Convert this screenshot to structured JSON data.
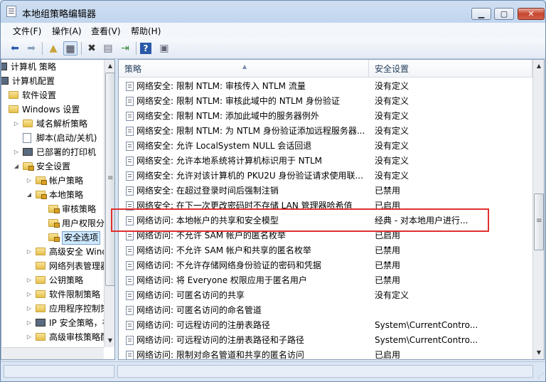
{
  "window": {
    "title": "本地组策略编辑器"
  },
  "menu": [
    "文件(F)",
    "操作(A)",
    "查看(V)",
    "帮助(H)"
  ],
  "toolbar": {
    "icons": [
      "back-arrow-icon",
      "forward-arrow-icon",
      "up-folder-icon",
      "show-hide-tree-icon",
      "delete-icon",
      "properties-icon",
      "export-list-icon",
      "help-icon",
      "view-icon"
    ]
  },
  "tree": [
    {
      "label": "计算机 策略",
      "indent": -6,
      "type": "pc",
      "expander": ""
    },
    {
      "label": "计算机配置",
      "indent": -4,
      "type": "pc",
      "expander": ""
    },
    {
      "label": "软件设置",
      "indent": 10,
      "type": "folder",
      "expander": ""
    },
    {
      "label": "Windows 设置",
      "indent": 10,
      "type": "folder",
      "expander": ""
    },
    {
      "label": "域名解析策略",
      "indent": 30,
      "type": "folder",
      "expander": "▷"
    },
    {
      "label": "脚本(启动/关机)",
      "indent": 30,
      "type": "doc",
      "expander": ""
    },
    {
      "label": "已部署的打印机",
      "indent": 30,
      "type": "pc",
      "expander": "▷"
    },
    {
      "label": "安全设置",
      "indent": 30,
      "type": "folder-lock",
      "expander": "◢"
    },
    {
      "label": "帐户策略",
      "indent": 48,
      "type": "folder-lock",
      "expander": "▷"
    },
    {
      "label": "本地策略",
      "indent": 48,
      "type": "folder-lock",
      "expander": "◢"
    },
    {
      "label": "审核策略",
      "indent": 66,
      "type": "folder-lock",
      "expander": ""
    },
    {
      "label": "用户权限分",
      "indent": 66,
      "type": "folder-lock",
      "expander": ""
    },
    {
      "label": "安全选项",
      "indent": 66,
      "type": "folder-lock",
      "expander": "",
      "selected": true
    },
    {
      "label": "高级安全 Wind",
      "indent": 48,
      "type": "folder",
      "expander": "▷"
    },
    {
      "label": "网络列表管理器",
      "indent": 48,
      "type": "folder",
      "expander": ""
    },
    {
      "label": "公钥策略",
      "indent": 48,
      "type": "folder",
      "expander": "▷"
    },
    {
      "label": "软件限制策略",
      "indent": 48,
      "type": "folder",
      "expander": "▷"
    },
    {
      "label": "应用程序控制策",
      "indent": 48,
      "type": "folder",
      "expander": "▷"
    },
    {
      "label": "IP 安全策略，在",
      "indent": 48,
      "type": "pc",
      "expander": "▷"
    },
    {
      "label": "高级审核策略配",
      "indent": 48,
      "type": "folder",
      "expander": "▷"
    }
  ],
  "columns": {
    "policy": "策略",
    "setting": "安全设置"
  },
  "rows": [
    {
      "policy": "网络安全: 限制 NTLM: 审核传入 NTLM 流量",
      "setting": "没有定义"
    },
    {
      "policy": "网络安全: 限制 NTLM: 审核此域中的 NTLM 身份验证",
      "setting": "没有定义"
    },
    {
      "policy": "网络安全: 限制 NTLM: 添加此域中的服务器例外",
      "setting": "没有定义"
    },
    {
      "policy": "网络安全: 限制 NTLM: 为 NTLM 身份验证添加远程服务器...",
      "setting": "没有定义"
    },
    {
      "policy": "网络安全: 允许 LocalSystem NULL 会话回退",
      "setting": "没有定义"
    },
    {
      "policy": "网络安全: 允许本地系统将计算机标识用于 NTLM",
      "setting": "没有定义"
    },
    {
      "policy": "网络安全: 允许对该计算机的 PKU2U 身份验证请求使用联...",
      "setting": "没有定义"
    },
    {
      "policy": "网络安全: 在超过登录时间后强制注销",
      "setting": "已禁用"
    },
    {
      "policy": "网络安全: 在下一次更改密码时不存储 LAN 管理器哈希值",
      "setting": "已启用"
    },
    {
      "policy": "网络访问: 本地帐户的共享和安全模型",
      "setting": "经典 - 对本地用户进行..."
    },
    {
      "policy": "网络访问: 不允许 SAM 帐户的匿名枚举",
      "setting": "已启用"
    },
    {
      "policy": "网络访问: 不允许 SAM 帐户和共享的匿名枚举",
      "setting": "已禁用"
    },
    {
      "policy": "网络访问: 不允许存储网络身份验证的密码和凭据",
      "setting": "已禁用"
    },
    {
      "policy": "网络访问: 将 Everyone 权限应用于匿名用户",
      "setting": "已禁用"
    },
    {
      "policy": "网络访问: 可匿名访问的共享",
      "setting": "没有定义"
    },
    {
      "policy": "网络访问: 可匿名访问的命名管道",
      "setting": ""
    },
    {
      "policy": "网络访问: 可远程访问的注册表路径",
      "setting": "System\\CurrentContro..."
    },
    {
      "policy": "网络访问: 可远程访问的注册表路径和子路径",
      "setting": "System\\CurrentContro..."
    },
    {
      "policy": "网络访问: 限制对命名管道和共享的匿名访问",
      "setting": "已启用"
    }
  ]
}
